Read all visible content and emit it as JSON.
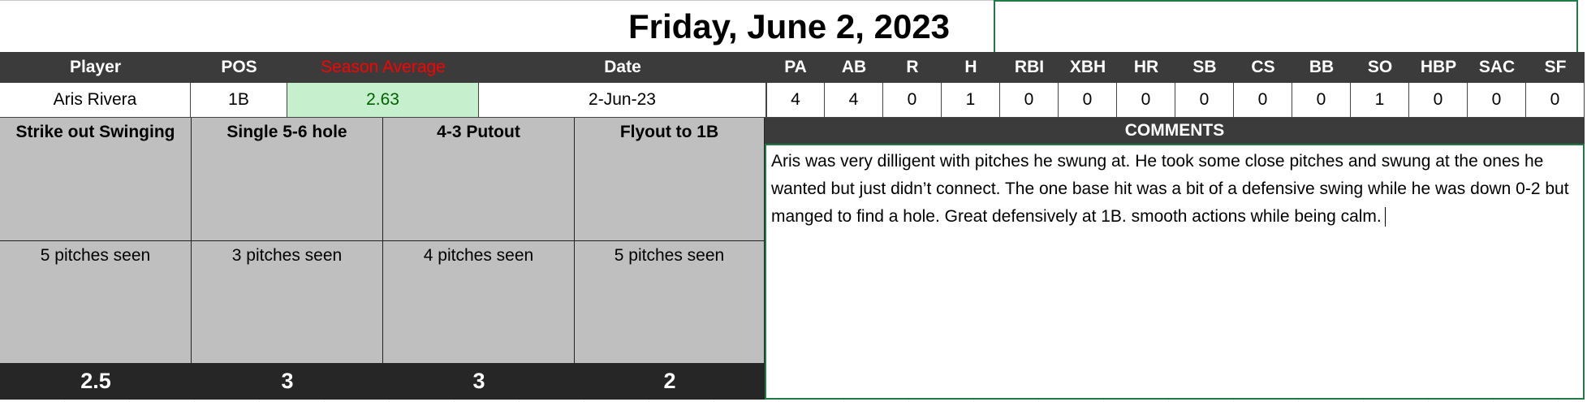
{
  "title": "Friday, June 2, 2023",
  "headers": [
    "Player",
    "POS",
    "Season Average",
    "Date",
    "PA",
    "AB",
    "R",
    "H",
    "RBI",
    "XBH",
    "HR",
    "SB",
    "CS",
    "BB",
    "SO",
    "HBP",
    "SAC",
    "SF"
  ],
  "row": {
    "player": "Aris Rivera",
    "pos": "1B",
    "season_average": "2.63",
    "date": "2-Jun-23",
    "stats": [
      "4",
      "4",
      "0",
      "1",
      "0",
      "0",
      "0",
      "0",
      "0",
      "0",
      "1",
      "0",
      "0",
      "0"
    ]
  },
  "at_bats": [
    {
      "result": "Strike out Swinging",
      "pitches": "5 pitches seen",
      "score": "2.5"
    },
    {
      "result": "Single 5-6 hole",
      "pitches": "3 pitches seen",
      "score": "3"
    },
    {
      "result": "4-3 Putout",
      "pitches": "4 pitches seen",
      "score": "3"
    },
    {
      "result": "Flyout to 1B",
      "pitches": "5 pitches seen",
      "score": "2"
    }
  ],
  "comments": {
    "label": "COMMENTS",
    "text": "Aris was very dilligent with pitches he swung at. He took some close pitches and swung at the ones he wanted but just didn’t connect. The one base hit was a bit of a defensive swing while he was down 0-2 but manged to find a hole. Great defensively at 1B. smooth actions while being calm."
  },
  "colors": {
    "header_bg": "#3b3b3b",
    "average_bg": "#c6efce",
    "average_text": "#006100",
    "at_bat_bg": "#bfbfbf",
    "score_bg": "#262626",
    "selection": "#1f7a45",
    "red_header": "#ff0000"
  }
}
